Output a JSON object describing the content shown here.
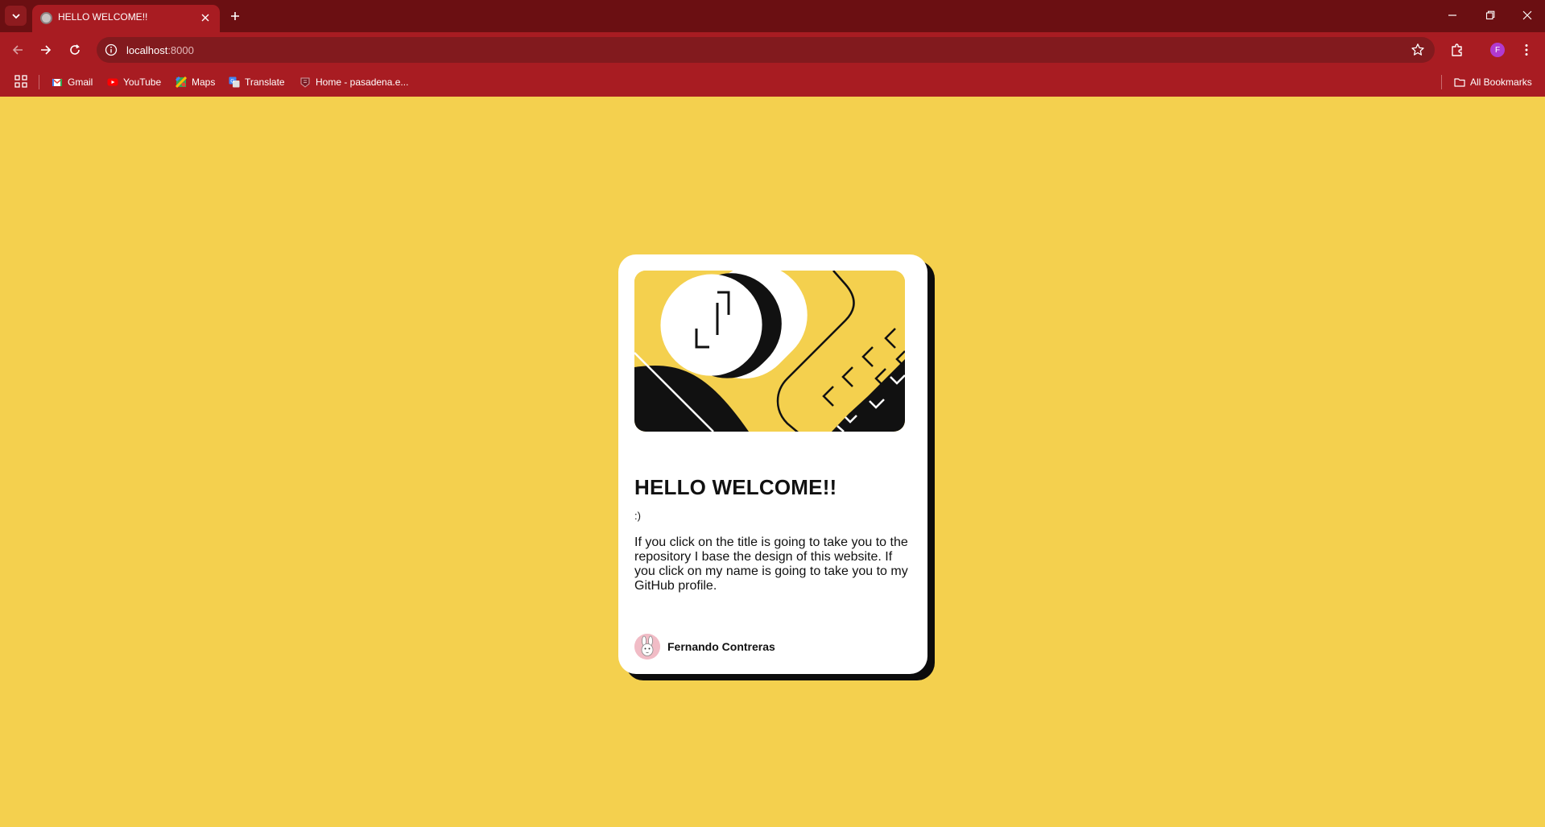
{
  "browser": {
    "tab": {
      "title": "HELLO WELCOME!!"
    },
    "address": {
      "host": "localhost",
      "port": ":8000"
    },
    "bookmarks": [
      {
        "label": "Gmail",
        "icon": "gmail-icon"
      },
      {
        "label": "YouTube",
        "icon": "youtube-icon"
      },
      {
        "label": "Maps",
        "icon": "maps-icon"
      },
      {
        "label": "Translate",
        "icon": "translate-icon"
      },
      {
        "label": "Home - pasadena.e...",
        "icon": "pasadena-icon"
      }
    ],
    "all_bookmarks_label": "All Bookmarks",
    "profile_initial": "F"
  },
  "card": {
    "title": "HELLO WELCOME!!",
    "subtitle": ":)",
    "description": "If you click on the title is going to take you to the repository I base the design of this website. If you click on my name is going to take you to my GitHub profile.",
    "author": "Fernando Contreras"
  },
  "colors": {
    "page_bg": "#f4d04e",
    "chrome_dark": "#6b0f12",
    "chrome": "#a81c22",
    "omnibox": "#821a1e",
    "card": "#ffffff",
    "ink": "#111111"
  }
}
